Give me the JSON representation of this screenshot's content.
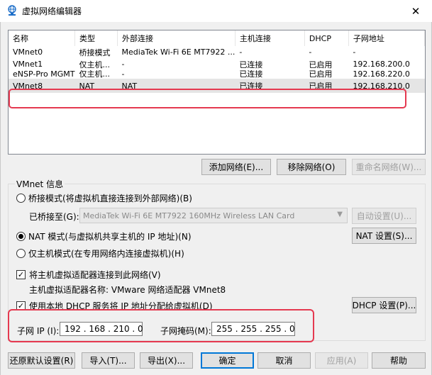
{
  "window": {
    "title": "虚拟网络编辑器",
    "close_glyph": "✕"
  },
  "list": {
    "headers": [
      "名称",
      "类型",
      "外部连接",
      "主机连接",
      "DHCP",
      "子网地址"
    ],
    "rows": [
      [
        "VMnet0",
        "桥接模式",
        "MediaTek Wi-Fi 6E MT7922 ...",
        "-",
        "-",
        "-"
      ],
      [
        "VMnet1",
        "仅主机...",
        "-",
        "已连接",
        "已启用",
        "192.168.200.0"
      ],
      [
        "eNSP-Pro MGMT",
        "仅主机...",
        "-",
        "已连接",
        "已启用",
        "192.168.220.0"
      ],
      [
        "VMnet8",
        "NAT",
        "NAT",
        "已连接",
        "已启用",
        "192.168.210.0"
      ]
    ]
  },
  "buttons": {
    "add_network": "添加网络(E)...",
    "remove_network": "移除网络(O)",
    "rename_network": "重命名网络(W)...",
    "auto_settings": "自动设置(U)...",
    "nat_settings": "NAT 设置(S)...",
    "dhcp_settings": "DHCP 设置(P)...",
    "restore_defaults": "还原默认设置(R)",
    "import": "导入(T)...",
    "export": "导出(X)...",
    "ok": "确定",
    "cancel": "取消",
    "apply": "应用(A)",
    "help": "帮助"
  },
  "vmnet_info": {
    "group_title": "VMnet 信息",
    "bridged_mode": "桥接模式(将虚拟机直接连接到外部网络)(B)",
    "bridged_to_label": "已桥接至(G):",
    "bridged_to_value": "MediaTek Wi-Fi 6E MT7922 160MHz Wireless LAN Card",
    "nat_mode": "NAT 模式(与虚拟机共享主机的 IP 地址)(N)",
    "host_only_mode": "仅主机模式(在专用网络内连接虚拟机)(H)",
    "connect_host_adapter": "将主机虚拟适配器连接到此网络(V)",
    "host_adapter_name": "主机虚拟适配器名称: VMware 网络适配器 VMnet8",
    "use_local_dhcp": "使用本地 DHCP 服务将 IP 地址分配给虚拟机(D)",
    "subnet_ip_label": "子网 IP (I):",
    "subnet_ip_value": "192 . 168 . 210 . 0",
    "subnet_mask_label": "子网掩码(M):",
    "subnet_mask_value": "255 . 255 . 255 . 0",
    "selected_mode": "nat",
    "connect_host_adapter_checked": true,
    "use_local_dhcp_checked": true
  },
  "colors": {
    "highlight": "#e53950",
    "accent": "#0078d7"
  }
}
